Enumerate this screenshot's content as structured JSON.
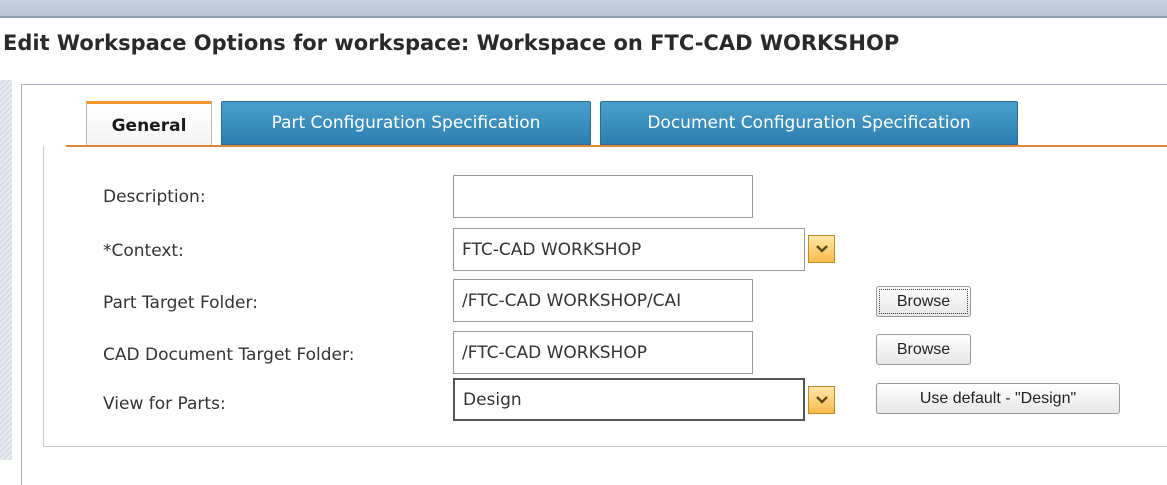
{
  "header": {
    "title": "Edit Workspace Options for workspace: Workspace on FTC-CAD WORKSHOP"
  },
  "tabs": [
    {
      "label": "General",
      "active": true
    },
    {
      "label": "Part Configuration Specification",
      "active": false
    },
    {
      "label": "Document Configuration Specification",
      "active": false
    }
  ],
  "form": {
    "description": {
      "label": "Description:",
      "value": ""
    },
    "context": {
      "label": "*Context:",
      "value": "FTC-CAD WORKSHOP",
      "icon": "chevron-down-icon"
    },
    "part_target_folder": {
      "label": "Part Target Folder:",
      "value": "/FTC-CAD WORKSHOP/CAI",
      "button": "Browse"
    },
    "cad_document_target_folder": {
      "label": "CAD Document Target Folder:",
      "value": "/FTC-CAD WORKSHOP",
      "button": "Browse"
    },
    "view_for_parts": {
      "label": "View for Parts:",
      "value": "Design",
      "icon": "chevron-down-icon",
      "button": "Use default - \"Design\""
    }
  },
  "colors": {
    "active_tab_accent": "#f0932b",
    "inactive_tab": "#3a8fc1",
    "select_arrow": "#f7bb4a"
  }
}
